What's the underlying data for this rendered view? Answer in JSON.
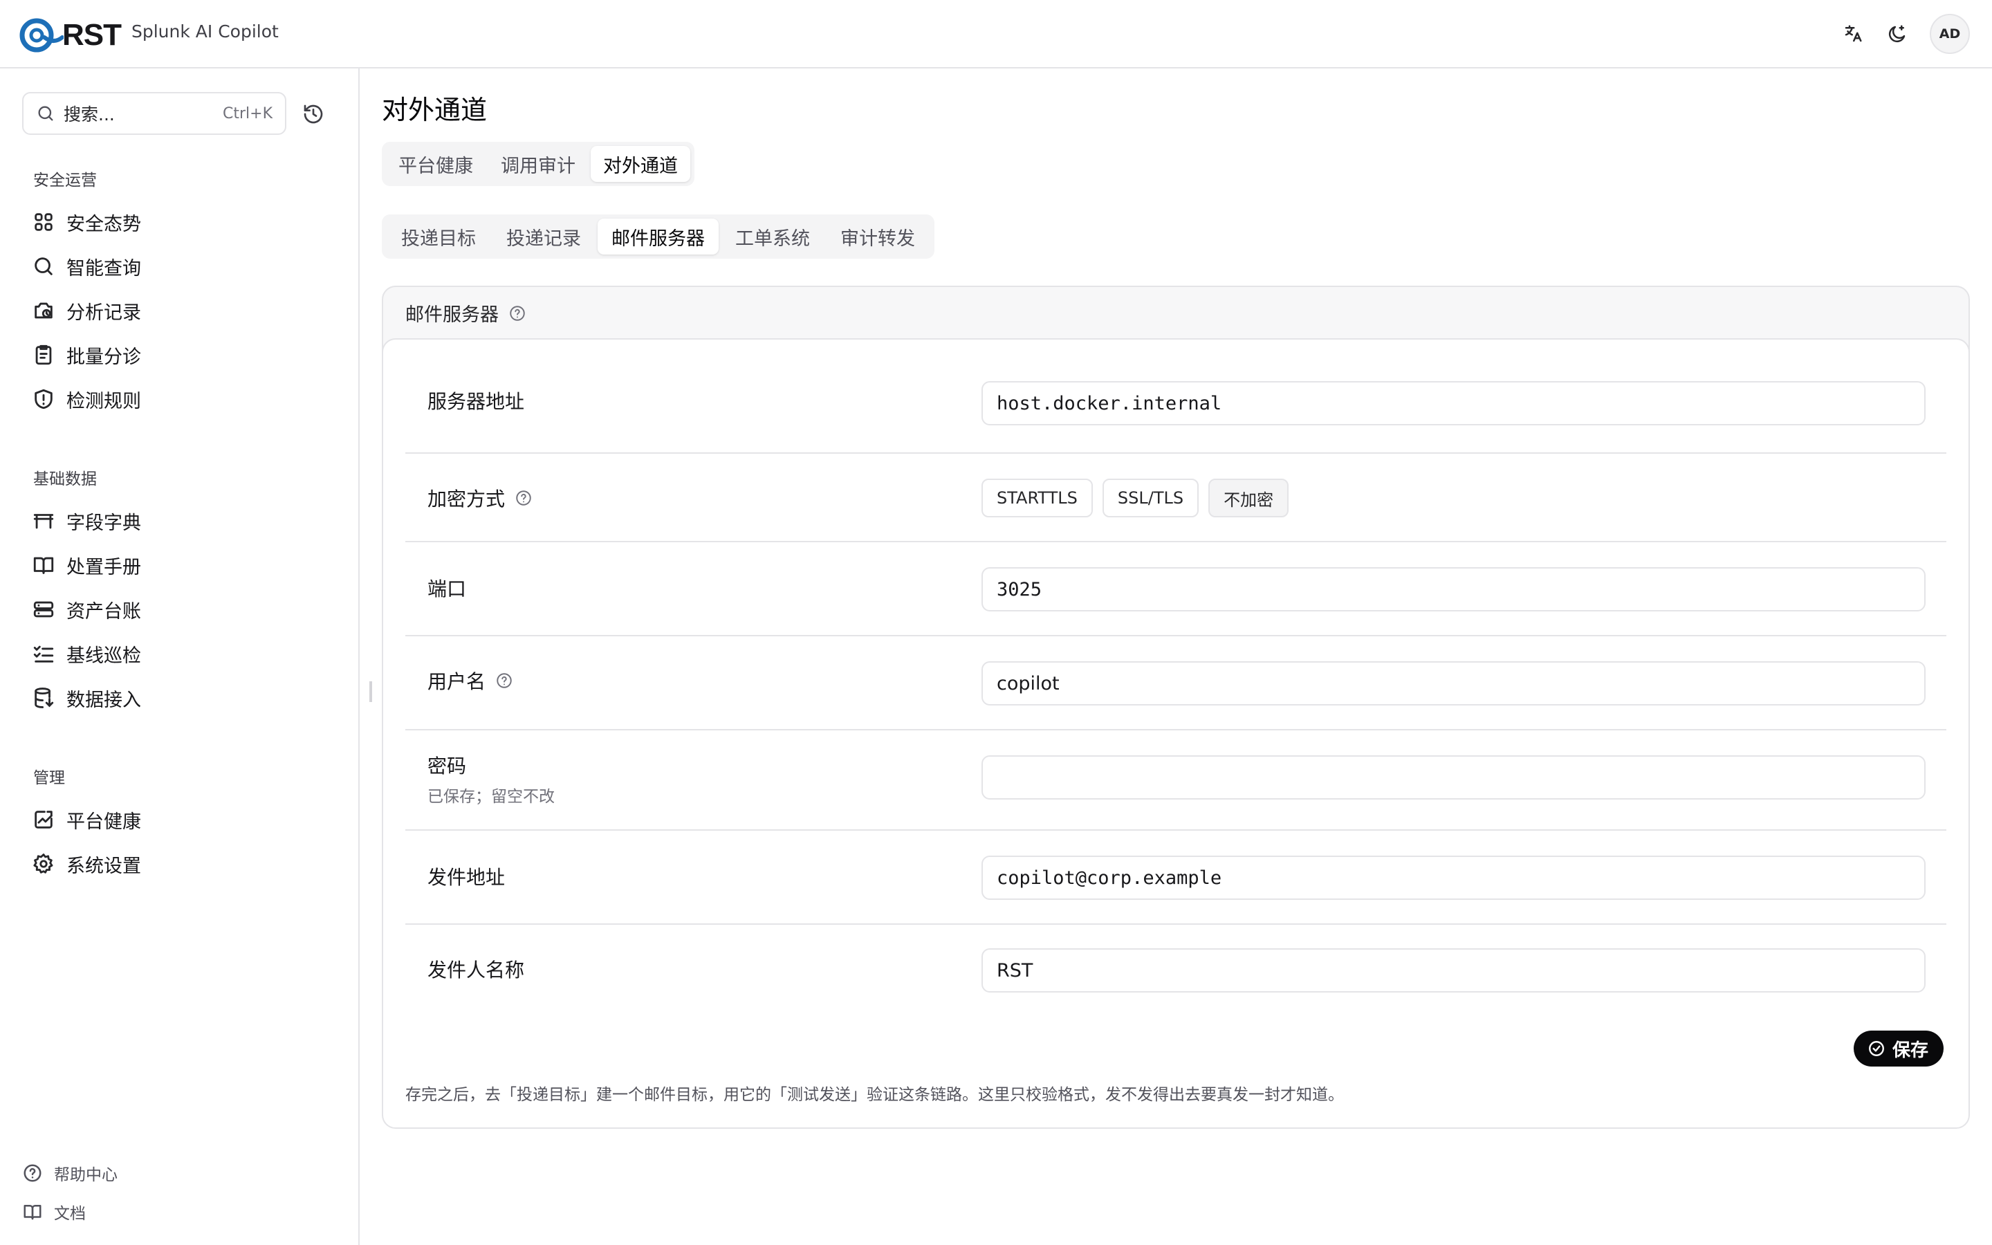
{
  "app": {
    "logo_text": "RST",
    "name": "Splunk AI Copilot",
    "avatar": "AD"
  },
  "colors": {
    "brand": "#1d6fb8",
    "primary_button": "#09090b",
    "border": "#e4e4e7"
  },
  "sidebar": {
    "search_placeholder": "搜索...",
    "search_shortcut": "Ctrl+K",
    "sections": [
      {
        "label": "安全运营",
        "items": [
          {
            "label": "安全态势",
            "icon": "grid-icon"
          },
          {
            "label": "智能查询",
            "icon": "search-icon"
          },
          {
            "label": "分析记录",
            "icon": "history-icon"
          },
          {
            "label": "批量分诊",
            "icon": "clipboard-icon"
          },
          {
            "label": "检测规则",
            "icon": "shield-alert-icon"
          }
        ]
      },
      {
        "label": "基础数据",
        "items": [
          {
            "label": "字段字典",
            "icon": "table-icon"
          },
          {
            "label": "处置手册",
            "icon": "book-open-icon"
          },
          {
            "label": "资产台账",
            "icon": "server-icon"
          },
          {
            "label": "基线巡检",
            "icon": "list-checks-icon"
          },
          {
            "label": "数据接入",
            "icon": "database-icon"
          }
        ]
      },
      {
        "label": "管理",
        "items": [
          {
            "label": "平台健康",
            "icon": "chart-icon"
          },
          {
            "label": "系统设置",
            "icon": "gear-icon"
          }
        ]
      }
    ],
    "footer": [
      {
        "label": "帮助中心",
        "icon": "help-circle-icon"
      },
      {
        "label": "文档",
        "icon": "book-icon"
      }
    ]
  },
  "page": {
    "title": "对外通道",
    "tabs": [
      "平台健康",
      "调用审计",
      "对外通道"
    ],
    "active_tab": "对外通道",
    "subtabs": [
      "投递目标",
      "投递记录",
      "邮件服务器",
      "工单系统",
      "审计转发"
    ],
    "active_subtab": "邮件服务器"
  },
  "mail_server": {
    "title": "邮件服务器",
    "host_label": "服务器地址",
    "host_value": "host.docker.internal",
    "encryption_label": "加密方式",
    "encryption_options": [
      "STARTTLS",
      "SSL/TLS",
      "不加密"
    ],
    "encryption_selected": "不加密",
    "port_label": "端口",
    "port_value": "3025",
    "username_label": "用户名",
    "username_value": "copilot",
    "password_label": "密码",
    "password_hint": "已保存；留空不改",
    "password_value": "",
    "from_address_label": "发件地址",
    "from_address_value": "copilot@corp.example",
    "from_name_label": "发件人名称",
    "from_name_value": "RST",
    "save_label": "保存",
    "footnote": "存完之后，去「投递目标」建一个邮件目标，用它的「测试发送」验证这条链路。这里只校验格式，发不发得出去要真发一封才知道。"
  }
}
